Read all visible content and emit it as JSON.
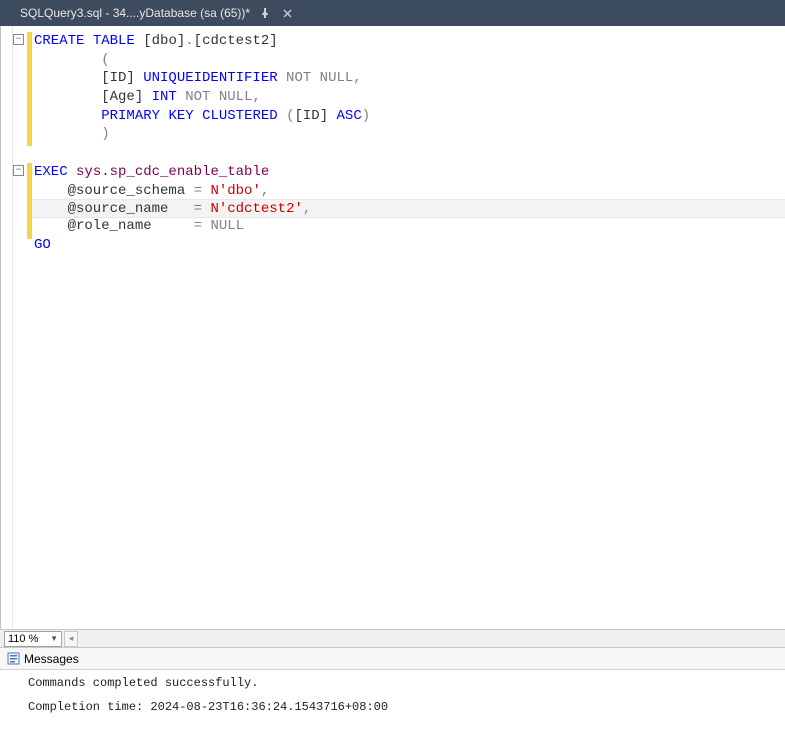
{
  "tab": {
    "title": "SQLQuery3.sql - 34....yDatabase (sa (65))*"
  },
  "zoom": {
    "value": "110 %"
  },
  "line_number_shown": "1",
  "messages": {
    "header": "Messages",
    "line1": "Commands completed successfully.",
    "line2": "Completion time: 2024-08-23T16:36:24.1543716+08:00"
  },
  "code": {
    "l1": {
      "a": "CREATE",
      "b": " ",
      "c": "TABLE",
      "d": " [dbo]",
      "e": ".",
      "f": "[cdctest2]"
    },
    "l2": {
      "a": "        (",
      "b": ""
    },
    "l3": {
      "a": "        [ID] ",
      "b": "UNIQUEIDENTIFIER",
      "c": " ",
      "d": "NOT",
      "e": " ",
      "f": "NULL",
      "g": ","
    },
    "l4": {
      "a": "        [Age] ",
      "b": "INT",
      "c": " ",
      "d": "NOT",
      "e": " ",
      "f": "NULL",
      "g": ","
    },
    "l5": {
      "a": "        ",
      "b": "PRIMARY",
      "c": " ",
      "d": "KEY",
      "e": " ",
      "f": "CLUSTERED",
      "g": " ",
      "h": "(",
      "i": "[ID] ",
      "j": "ASC",
      "k": ")"
    },
    "l6": {
      "a": "        )"
    },
    "l7": {
      "a": ""
    },
    "l8": {
      "a": "EXEC",
      "b": " ",
      "c": "sys.sp_cdc_enable_table"
    },
    "l9": {
      "a": "    @source_schema ",
      "b": "=",
      "c": " ",
      "d": "N'dbo'",
      "e": ","
    },
    "l10": {
      "a": "    @source_name   ",
      "b": "=",
      "c": " ",
      "d": "N'cdctest2'",
      "e": ","
    },
    "l11": {
      "a": "    @role_name     ",
      "b": "=",
      "c": " ",
      "d": "NULL"
    },
    "l12": {
      "a": "GO"
    }
  }
}
